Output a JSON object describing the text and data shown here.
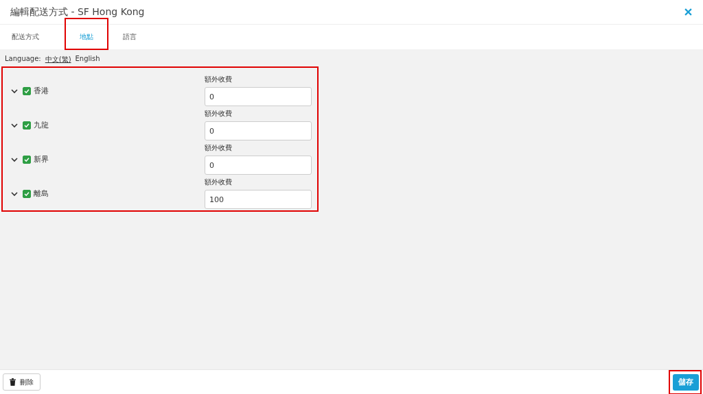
{
  "window": {
    "title": "編輯配送方式 - SF Hong Kong"
  },
  "tabs": [
    {
      "label": "配送方式",
      "selected": false,
      "highlighted": false
    },
    {
      "label": "地點",
      "selected": true,
      "highlighted": true
    },
    {
      "label": "語言",
      "selected": false,
      "highlighted": false
    }
  ],
  "language": {
    "label": "Language:",
    "options": [
      {
        "label": "中文(繁)",
        "selected": true
      },
      {
        "label": "English",
        "selected": false
      }
    ]
  },
  "regions_highlighted": true,
  "regions": [
    {
      "name": "香港",
      "expanded": false,
      "checked": true,
      "fee_label": "額外收費",
      "fee": "0"
    },
    {
      "name": "九龍",
      "expanded": false,
      "checked": true,
      "fee_label": "額外收費",
      "fee": "0"
    },
    {
      "name": "新界",
      "expanded": false,
      "checked": true,
      "fee_label": "額外收費",
      "fee": "0"
    },
    {
      "name": "離島",
      "expanded": false,
      "checked": true,
      "fee_label": "額外收費",
      "fee": "100"
    }
  ],
  "footer": {
    "delete_button": {
      "label": "刪除"
    },
    "save_button": {
      "label": "儲存",
      "highlighted": true
    }
  }
}
